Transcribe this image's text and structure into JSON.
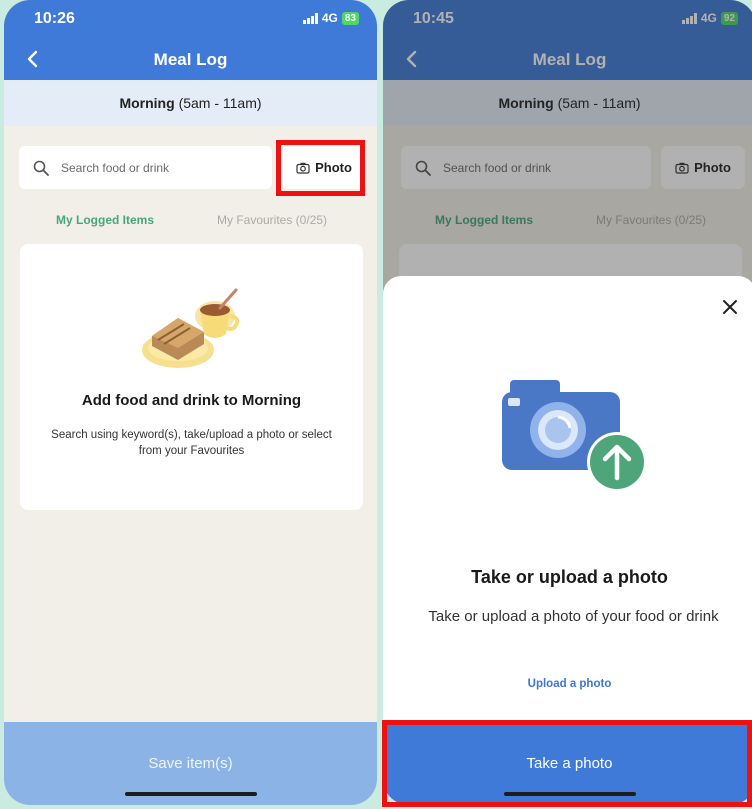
{
  "left": {
    "status": {
      "time": "10:26",
      "network": "4G",
      "battery": "83"
    },
    "nav": {
      "title": "Meal Log"
    },
    "period": {
      "name": "Morning",
      "range": "(5am - 11am)"
    },
    "search": {
      "placeholder": "Search food or drink"
    },
    "photo_button": "Photo",
    "tabs": {
      "logged": "My Logged Items",
      "favourites": "My Favourites (0/25)"
    },
    "empty_state": {
      "title": "Add food and drink to Morning",
      "description": "Search using keyword(s), take/upload a photo or select from your Favourites"
    },
    "save_button": "Save item(s)"
  },
  "right": {
    "status": {
      "time": "10:45",
      "network": "4G",
      "battery": "92"
    },
    "nav": {
      "title": "Meal Log"
    },
    "period": {
      "name": "Morning",
      "range": "(5am - 11am)"
    },
    "search": {
      "placeholder": "Search food or drink"
    },
    "photo_button": "Photo",
    "tabs": {
      "logged": "My Logged Items",
      "favourites": "My Favourites (0/25)"
    },
    "sheet": {
      "title": "Take or upload a photo",
      "description": "Take or upload a photo of your food or drink",
      "upload_link": "Upload a photo",
      "take_button": "Take a photo"
    }
  },
  "colors": {
    "background": "#c9ebe0",
    "header": "#3f7ad8",
    "accent_green": "#49a57a",
    "highlight": "#ee1111",
    "save_disabled": "#8cb3e6"
  }
}
